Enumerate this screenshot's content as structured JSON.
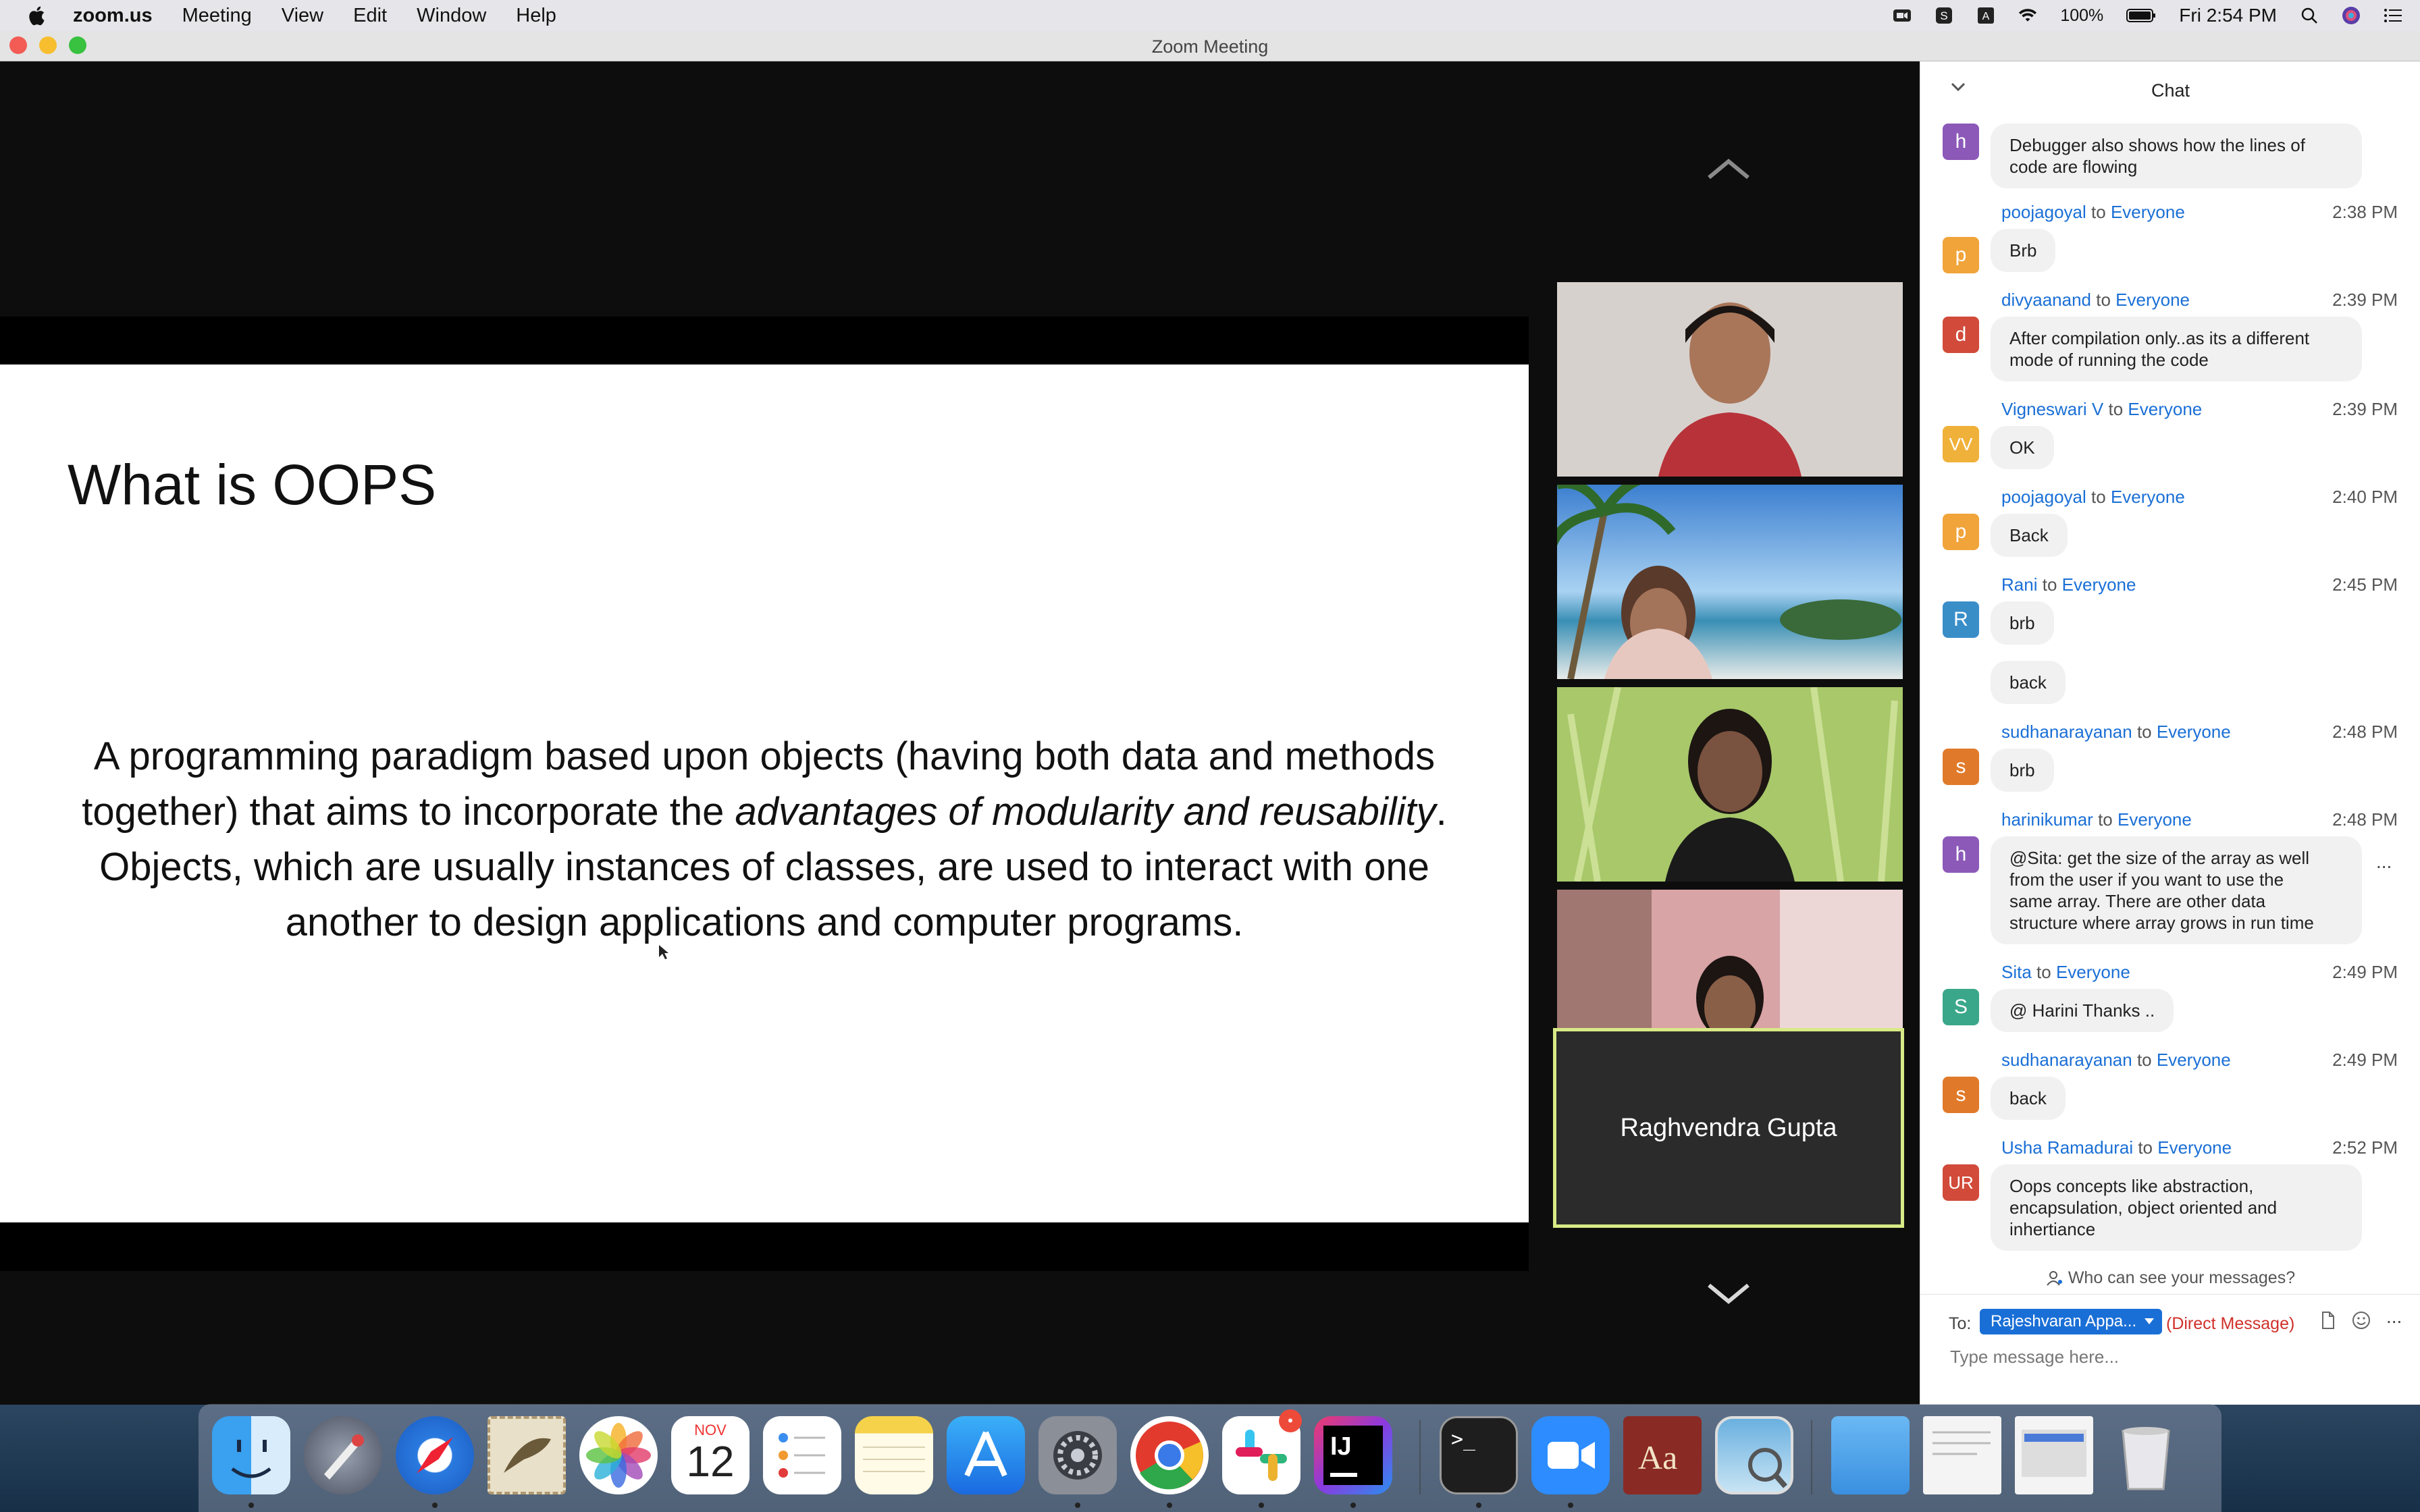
{
  "menubar": {
    "app": "zoom.us",
    "items": [
      "Meeting",
      "View",
      "Edit",
      "Window",
      "Help"
    ],
    "battery": "100%",
    "clock": "Fri 2:54 PM"
  },
  "window": {
    "title": "Zoom Meeting"
  },
  "slide": {
    "title": "What is OOPS",
    "body_1": "A programming paradigm based upon objects (having both data and methods together) that aims to incorporate the ",
    "body_em": "advantages of modularity and reusability",
    "body_2": ". Objects, which are usually instances of classes, are used to interact with one another to design applications and computer programs."
  },
  "participants": {
    "active_name": "Raghvendra Gupta"
  },
  "chat": {
    "title": "Chat",
    "messages": [
      {
        "initial": "h",
        "color": "#8c59b8",
        "sender": "",
        "to": "",
        "recipient": "",
        "time": "",
        "lines": [
          "Debugger also shows how the lines of",
          "code are flowing"
        ]
      },
      {
        "initial": "p",
        "color": "#f0a43a",
        "sender": "poojagoyal",
        "to": "to",
        "recipient": "Everyone",
        "time": "2:38 PM",
        "lines": [
          "Brb"
        ]
      },
      {
        "initial": "d",
        "color": "#d14a3a",
        "sender": "divyaanand",
        "to": "to",
        "recipient": "Everyone",
        "time": "2:39 PM",
        "lines": [
          "After compilation only..as its a different",
          "mode of running the code"
        ]
      },
      {
        "initial": "VV",
        "color": "#f0b13a",
        "sender": "Vigneswari V",
        "to": "to",
        "recipient": "Everyone",
        "time": "2:39 PM",
        "lines": [
          "OK"
        ]
      },
      {
        "initial": "p",
        "color": "#f0a43a",
        "sender": "poojagoyal",
        "to": "to",
        "recipient": "Everyone",
        "time": "2:40 PM",
        "lines": [
          "Back"
        ]
      },
      {
        "initial": "R",
        "color": "#3a8ec8",
        "sender": "Rani",
        "to": "to",
        "recipient": "Everyone",
        "time": "2:45 PM",
        "lines": [
          "brb"
        ]
      },
      {
        "initial": "",
        "color": "",
        "sender": "",
        "to": "",
        "recipient": "",
        "time": "",
        "lines": [
          "back"
        ]
      },
      {
        "initial": "s",
        "color": "#e07a2a",
        "sender": "sudhanarayanan",
        "to": "to",
        "recipient": "Everyone",
        "time": "2:48 PM",
        "lines": [
          "brb"
        ]
      },
      {
        "initial": "h",
        "color": "#8c59b8",
        "sender": "harinikumar",
        "to": "to",
        "recipient": "Everyone",
        "time": "2:48 PM",
        "lines": [
          "@Sita: get the size of the array as well",
          "from the user if you want to use the",
          "same array. There are other data",
          "structure where array grows in run time"
        ]
      },
      {
        "initial": "S",
        "color": "#3aa78a",
        "sender": "Sita",
        "to": "to",
        "recipient": "Everyone",
        "time": "2:49 PM",
        "lines": [
          "@ Harini Thanks .."
        ]
      },
      {
        "initial": "s",
        "color": "#e07a2a",
        "sender": "sudhanarayanan",
        "to": "to",
        "recipient": "Everyone",
        "time": "2:49 PM",
        "lines": [
          "back"
        ]
      },
      {
        "initial": "UR",
        "color": "#d14a3a",
        "sender": "Usha Ramadurai",
        "to": "to",
        "recipient": "Everyone",
        "time": "2:52 PM",
        "lines": [
          "Oops concepts like abstraction,",
          "encapsulation, object oriented and",
          "inhertiance"
        ]
      }
    ],
    "who_can_see": "Who can see your messages?",
    "to_label": "To:",
    "recipient": "Rajeshvaran Appa...",
    "direct": "(Direct Message)",
    "more": "...",
    "placeholder": "Type message here..."
  },
  "dock": {
    "calendar_month": "NOV",
    "calendar_day": "12",
    "slack_badge": "•",
    "intellij": "IJ",
    "terminal": ">_",
    "dictionary": "Aa"
  }
}
